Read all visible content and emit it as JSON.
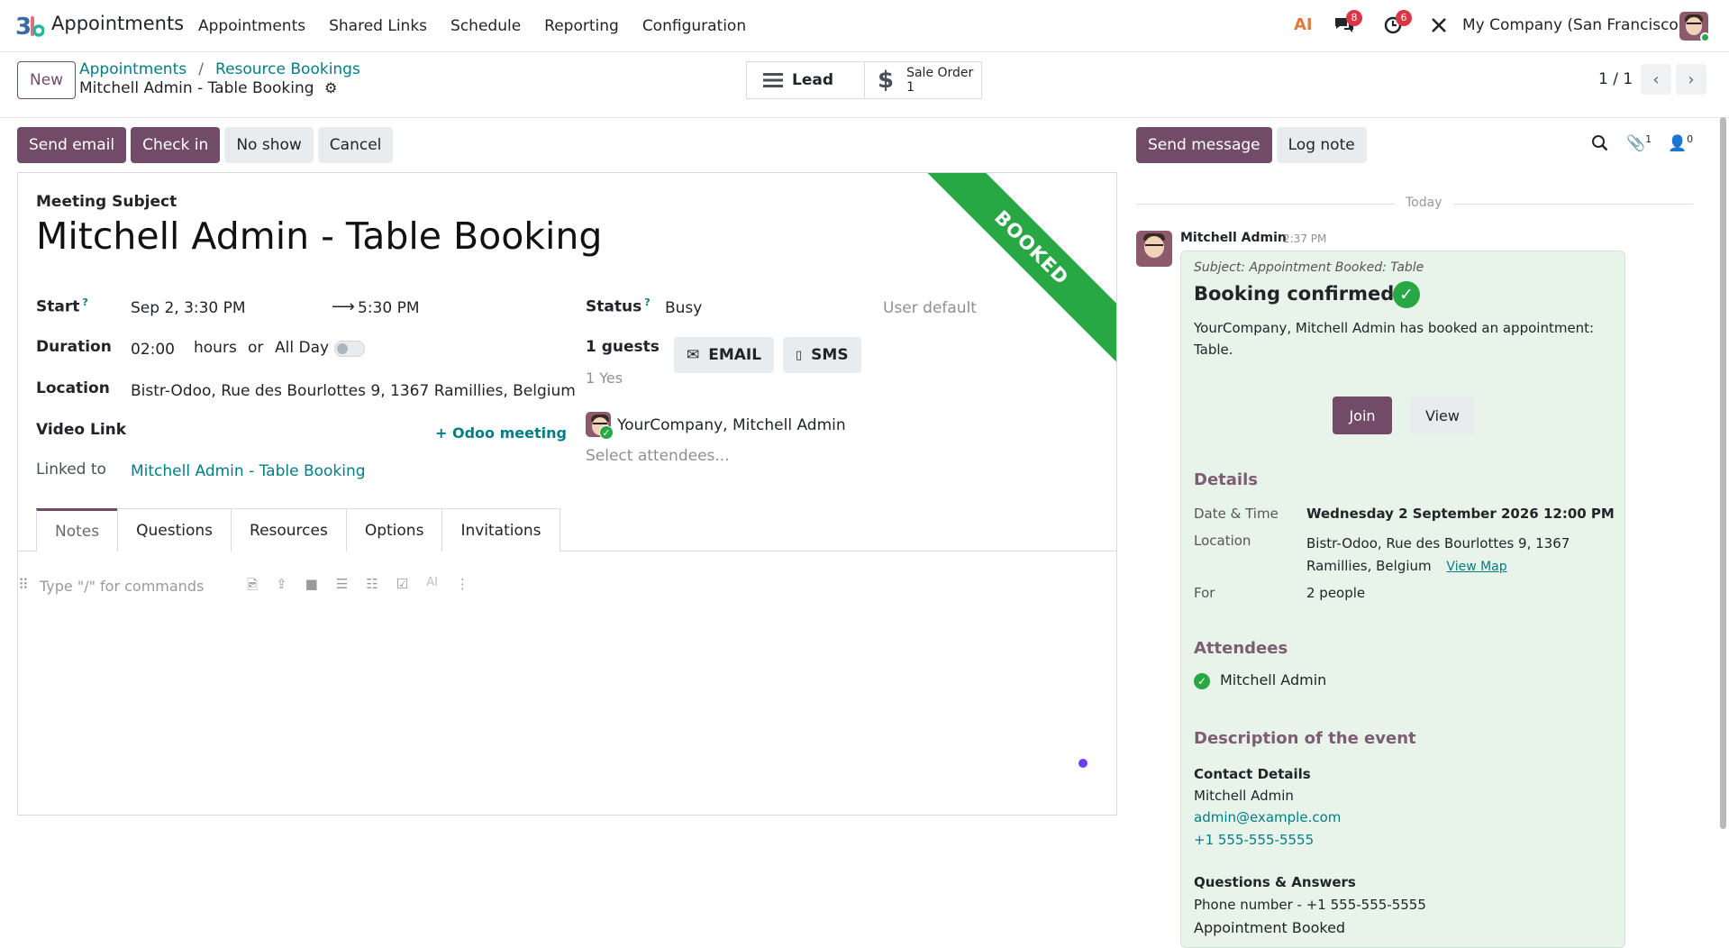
{
  "navbar": {
    "app_name": "Appointments",
    "menu": [
      "Appointments",
      "Shared Links",
      "Schedule",
      "Reporting",
      "Configuration"
    ],
    "ai_label": "AI",
    "messages_count": "8",
    "activities_count": "6",
    "company": "My Company (San Francisco)"
  },
  "control": {
    "new_label": "New",
    "breadcrumb_1": "Appointments",
    "breadcrumb_sep": "/",
    "breadcrumb_2": "Resource Bookings",
    "record_name": "Mitchell Admin - Table Booking",
    "stat_lead": "Lead",
    "stat_sale_label": "Sale Order",
    "stat_sale_value": "1",
    "pager": "1 / 1"
  },
  "actions": {
    "send_email": "Send email",
    "check_in": "Check in",
    "no_show": "No show",
    "cancel": "Cancel"
  },
  "form": {
    "ribbon": "BOOKED",
    "subject_label": "Meeting Subject",
    "subject": "Mitchell Admin - Table Booking",
    "start_label": "Start",
    "help_mark": "?",
    "start": "Sep 2, 3:30 PM",
    "stop": "5:30 PM",
    "duration_label": "Duration",
    "duration": "02:00",
    "hours": "hours",
    "or": "or",
    "allday": "All Day",
    "location_label": "Location",
    "location": "Bistr-Odoo, Rue des Bourlottes 9, 1367 Ramillies, Belgium",
    "video_label": "Video Link",
    "odoo_meeting": "Odoo meeting",
    "linked_label": "Linked to",
    "linked": "Mitchell Admin - Table Booking",
    "status_label": "Status",
    "status": "Busy",
    "user_default": "User default",
    "guests": "1 guests",
    "yes": "1 Yes",
    "email_btn": "EMAIL",
    "sms_btn": "SMS",
    "attendee": "YourCompany, Mitchell Admin",
    "select_attendees": "Select attendees...",
    "tabs": [
      "Notes",
      "Questions",
      "Resources",
      "Options",
      "Invitations"
    ],
    "notes_placeholder": "Type \"/\" for commands"
  },
  "chatter": {
    "send_message": "Send message",
    "log_note": "Log note",
    "attachments_count": "1",
    "followers_count": "0",
    "today": "Today",
    "author": "Mitchell Admin",
    "time": "2:37 PM",
    "subject": "Subject: Appointment Booked: Table",
    "booking_confirmed": "Booking confirmed",
    "intro_line1": "YourCompany, Mitchell Admin has booked an appointment:",
    "intro_line2": "Table.",
    "join": "Join",
    "view": "View",
    "details_title": "Details",
    "date_label": "Date & Time",
    "date_value": "Wednesday 2 September 2026 12:00 PM",
    "location_label": "Location",
    "location_line1": "Bistr-Odoo, Rue des Bourlottes 9, 1367",
    "location_line2": "Ramillies, Belgium",
    "view_map": "View Map",
    "for_label": "For",
    "for_value": "2 people",
    "attendees_title": "Attendees",
    "attendee_name": "Mitchell Admin",
    "description_title": "Description of the event",
    "contact_title": "Contact Details",
    "contact_name": "Mitchell Admin",
    "contact_email": "admin@example.com",
    "contact_phone": "+1 555-555-5555",
    "qa_title": "Questions & Answers",
    "qa_phone": "Phone number - +1 555-555-5555",
    "qa_status": "Appointment Booked"
  },
  "colors": {
    "brand": "#714b67",
    "link": "#017e84",
    "success": "#28a745",
    "badge": "#dc3545"
  }
}
